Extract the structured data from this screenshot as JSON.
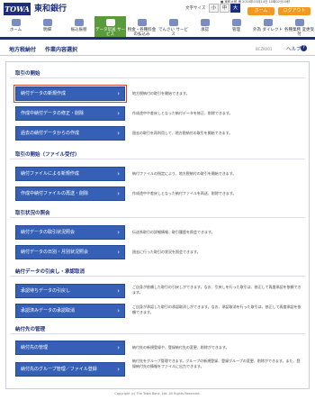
{
  "brand": {
    "logo": "TOWA",
    "name": "東和銀行"
  },
  "header": {
    "user_info": "■ 東和太郎 様 2010年03月14日 10時02分00秒",
    "fontsize_label": "文字サイズ",
    "fontsize_options": [
      "小",
      "中",
      "大"
    ],
    "home": "ホーム",
    "logout": "ログアウト"
  },
  "nav": {
    "items": [
      {
        "label": "ホーム",
        "icon": "home-icon",
        "active": false
      },
      {
        "label": "明細",
        "icon": "statement-icon",
        "active": false
      },
      {
        "label": "振込振替",
        "icon": "transfer-icon",
        "active": false
      },
      {
        "label": "データ伝送 サービス",
        "icon": "data-transmission-icon",
        "active": true
      },
      {
        "label": "税金・各種料金の払込み",
        "icon": "tax-icon",
        "active": false
      },
      {
        "label": "でんさい サービス",
        "icon": "densai-icon",
        "active": false
      },
      {
        "label": "承認",
        "icon": "approval-icon",
        "active": false
      },
      {
        "label": "管理",
        "icon": "admin-icon",
        "active": false
      },
      {
        "label": "外為 ダイレクト",
        "icon": "forex-icon",
        "active": false
      },
      {
        "label": "各種業務 変更受付",
        "icon": "settings-icon",
        "active": false
      }
    ]
  },
  "breadcrumb": {
    "category": "地方税納付",
    "page_title": "作業内容選択",
    "screen_id": "BCZK001",
    "help_label": "ヘルプ",
    "help_icon": "?"
  },
  "sections": [
    {
      "title": "取引の開始",
      "items": [
        {
          "label": "納付データの新規作成",
          "desc": "地方税納付の取引を開始できます。",
          "highlight": true
        },
        {
          "label": "作成中納付データの修正・削除",
          "desc": "作成途中や差戻しとなった納付データを修正、削除できます。",
          "highlight": false
        },
        {
          "label": "過去の納付データからの作成",
          "desc": "過去の取引を再利用して、地方税納付の取引を開始できます。",
          "highlight": false
        }
      ]
    },
    {
      "title": "取引の開始（ファイル受付）",
      "items": [
        {
          "label": "納付ファイルによる新規作成",
          "desc": "納付ファイルの指定により、地方税納付の取引を開始できます。",
          "highlight": false
        },
        {
          "label": "作成中納付ファイルの再送・削除",
          "desc": "作成途中や差戻しとなった納付ファイルを再送、削除できます。",
          "highlight": false
        }
      ]
    },
    {
      "title": "取引状況の照会",
      "items": [
        {
          "label": "納付データの取引状況照会",
          "desc": "伝送系取引の詳細情報、取引履歴を照会できます。",
          "highlight": false
        },
        {
          "label": "納付データの日別・月別状況照会",
          "desc": "過去に行った取引の状況を照会できます。",
          "highlight": false
        }
      ]
    },
    {
      "title": "納付データの引戻し・承認取消",
      "items": [
        {
          "label": "承認待ちデータの引戻し",
          "desc": "ご自身が依頼した取引の引戻しができます。なお、引戻しを行った取引は、修正して再度承認を依頼できます。",
          "highlight": false
        },
        {
          "label": "承認済みデータの承認取消",
          "desc": "ご自身が承認した取引の承認取消しができます。なお、承認取消を行った取引は、修正して再度承認を依頼できます。",
          "highlight": false
        }
      ]
    },
    {
      "title": "納付先の管理",
      "items": [
        {
          "label": "納付先の管理",
          "desc": "納付先の新規登録や、登録納付先の変更、削除ができます。",
          "highlight": false
        },
        {
          "label": "納付先のグループ管理／ファイル登録",
          "desc": "納付先をグループ管理できます。グループの新規登録、登録グループの変更、削除ができます。また、登録納付先の情報をファイルに出力できます。",
          "highlight": false
        }
      ]
    }
  ],
  "footer": {
    "copyright": "Copyright (c) The Towa Bank, Ltd. All Rights Reserved."
  },
  "colors": {
    "brand_navy": "#1d2f7c",
    "button_blue": "#3560b5",
    "active_green": "#5a9a3a",
    "orange": "#f39a1e",
    "highlight_red": "#d9412f"
  }
}
